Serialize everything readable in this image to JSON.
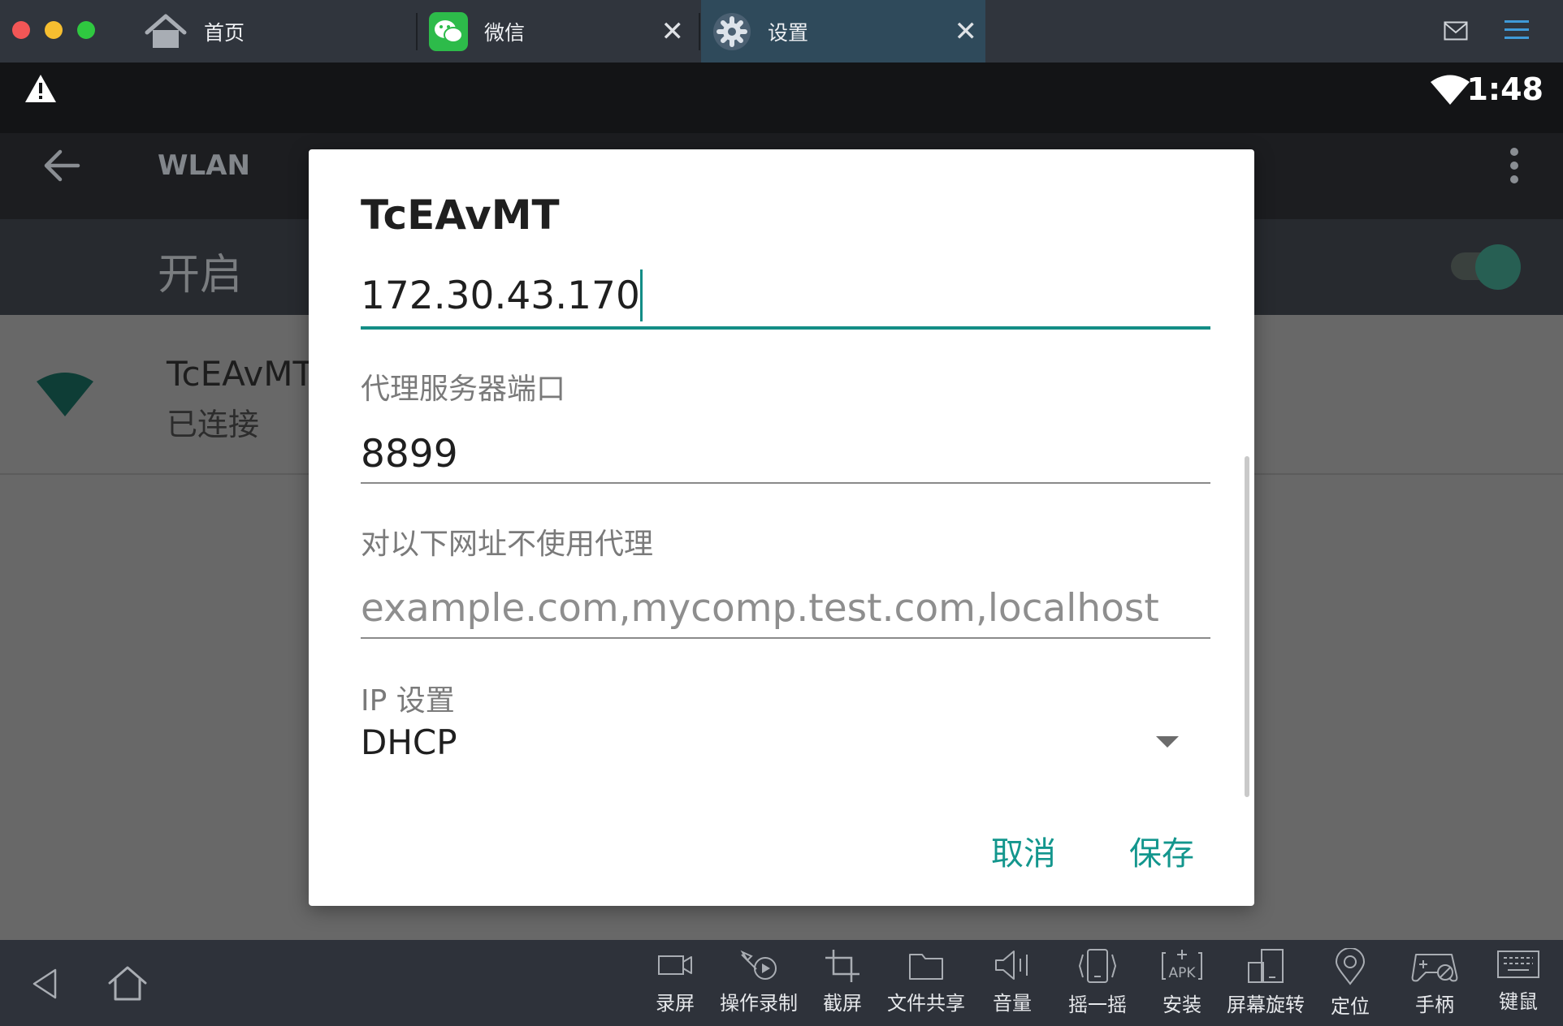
{
  "window": {
    "tabs": [
      {
        "label": "首页",
        "icon": "home-icon",
        "active": false
      },
      {
        "label": "微信",
        "icon": "wechat-icon",
        "active": false,
        "closable": true
      },
      {
        "label": "设置",
        "icon": "settings-gear-icon",
        "active": true,
        "closable": true
      }
    ],
    "right_icons": [
      "mail-icon",
      "menu-icon"
    ]
  },
  "statusbar": {
    "alert_icon": "warning-icon",
    "wifi_icon": "wifi-icon",
    "time": "1:48"
  },
  "actionbar": {
    "back_icon": "back-arrow-icon",
    "title": "WLAN",
    "overflow_icon": "more-vert-icon"
  },
  "wifi_switch": {
    "label": "开启",
    "state": "on"
  },
  "network": {
    "name": "TcEAvMT",
    "status": "已连接",
    "icon": "wifi-signal-icon"
  },
  "dialog": {
    "title": "TcEAvMT",
    "proxy_host_value": "172.30.43.170",
    "proxy_port_label": "代理服务器端口",
    "proxy_port_value": "8899",
    "bypass_label": "对以下网址不使用代理",
    "bypass_placeholder": "example.com,mycomp.test.com,localhost",
    "ip_settings_label": "IP 设置",
    "ip_settings_value": "DHCP",
    "cancel_label": "取消",
    "save_label": "保存"
  },
  "navbar": {
    "back_icon": "nav-back-icon",
    "home_icon": "nav-home-icon"
  },
  "toolbar": {
    "tools": [
      {
        "label": "录屏",
        "icon": "record-screen-icon"
      },
      {
        "label": "操作录制",
        "icon": "macro-record-icon"
      },
      {
        "label": "截屏",
        "icon": "crop-screenshot-icon"
      },
      {
        "label": "文件共享",
        "icon": "folder-share-icon"
      },
      {
        "label": "音量",
        "icon": "volume-icon"
      },
      {
        "label": "摇一摇",
        "icon": "shake-icon"
      },
      {
        "label": "安装",
        "icon": "apk-install-icon"
      },
      {
        "label": "屏幕旋转",
        "icon": "rotate-screen-icon"
      },
      {
        "label": "定位",
        "icon": "location-pin-icon"
      },
      {
        "label": "手柄",
        "icon": "gamepad-icon"
      },
      {
        "label": "键鼠",
        "icon": "keyboard-icon"
      }
    ]
  },
  "colors": {
    "accent": "#13968d",
    "titlebar": "#30353d",
    "toolbar": "#2e323a",
    "scrim": "#686868"
  }
}
